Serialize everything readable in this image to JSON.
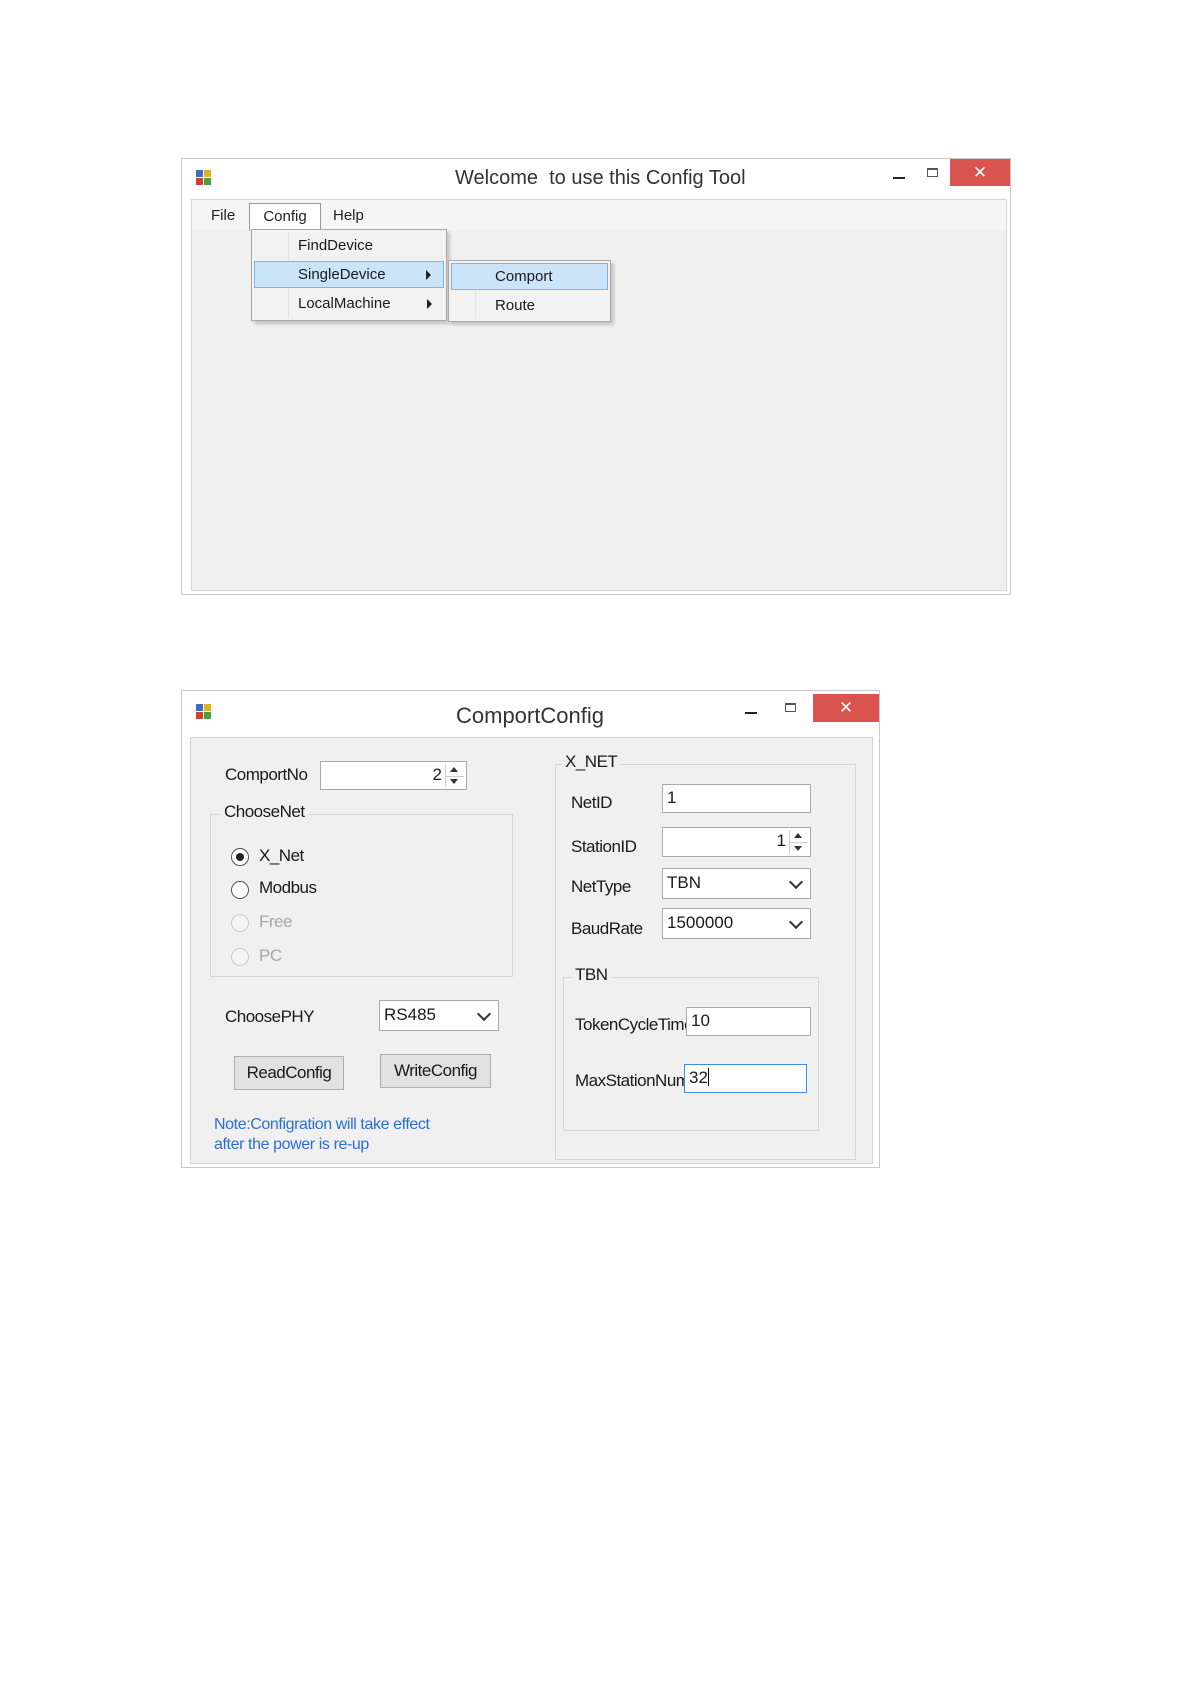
{
  "window1": {
    "title": "Welcome  to use this Config Tool",
    "controls": {
      "minimize": "–",
      "maximize": "□",
      "close": "✕"
    },
    "menubar": [
      "File",
      "Config",
      "Help"
    ],
    "config_menu": {
      "items": [
        {
          "label": "FindDevice",
          "has_submenu": false
        },
        {
          "label": "SingleDevice",
          "has_submenu": true,
          "highlighted": true
        },
        {
          "label": "LocalMachine",
          "has_submenu": true
        }
      ]
    },
    "submenu": {
      "items": [
        {
          "label": "Comport",
          "highlighted": true
        },
        {
          "label": "Route"
        }
      ]
    }
  },
  "window2": {
    "title": "ComportConfig",
    "controls": {
      "minimize": "–",
      "maximize": "□",
      "close": "✕"
    },
    "comport": {
      "label": "ComportNo",
      "value": "2"
    },
    "choose_net": {
      "title": "ChooseNet",
      "options": [
        {
          "label": "X_Net",
          "checked": true,
          "enabled": true
        },
        {
          "label": "Modbus",
          "checked": false,
          "enabled": true
        },
        {
          "label": "Free",
          "checked": false,
          "enabled": false
        },
        {
          "label": "PC",
          "checked": false,
          "enabled": false
        }
      ]
    },
    "choose_phy": {
      "label": "ChoosePHY",
      "value": "RS485"
    },
    "buttons": {
      "read": "ReadConfig",
      "write": "WriteConfig"
    },
    "note": {
      "line1": "Note:Configration will take effect",
      "line2": "after the power is re-up"
    },
    "x_net": {
      "title": "X_NET",
      "net_id": {
        "label": "NetID",
        "value": "1"
      },
      "station_id": {
        "label": "StationID",
        "value": "1"
      },
      "net_type": {
        "label": "NetType",
        "value": "TBN"
      },
      "baud_rate": {
        "label": "BaudRate",
        "value": "1500000"
      },
      "tbn": {
        "title": "TBN",
        "token_cycle_time": {
          "label": "TokenCycleTime",
          "value": "10"
        },
        "max_station_num": {
          "label": "MaxStationNum",
          "value": "32"
        }
      }
    }
  },
  "colors": {
    "close_button": "#d9534f",
    "highlight": "#cce4f7",
    "highlight_border": "#7eb4ea",
    "note_text": "#2a6fd6",
    "focus_border": "#3d8ee0"
  }
}
